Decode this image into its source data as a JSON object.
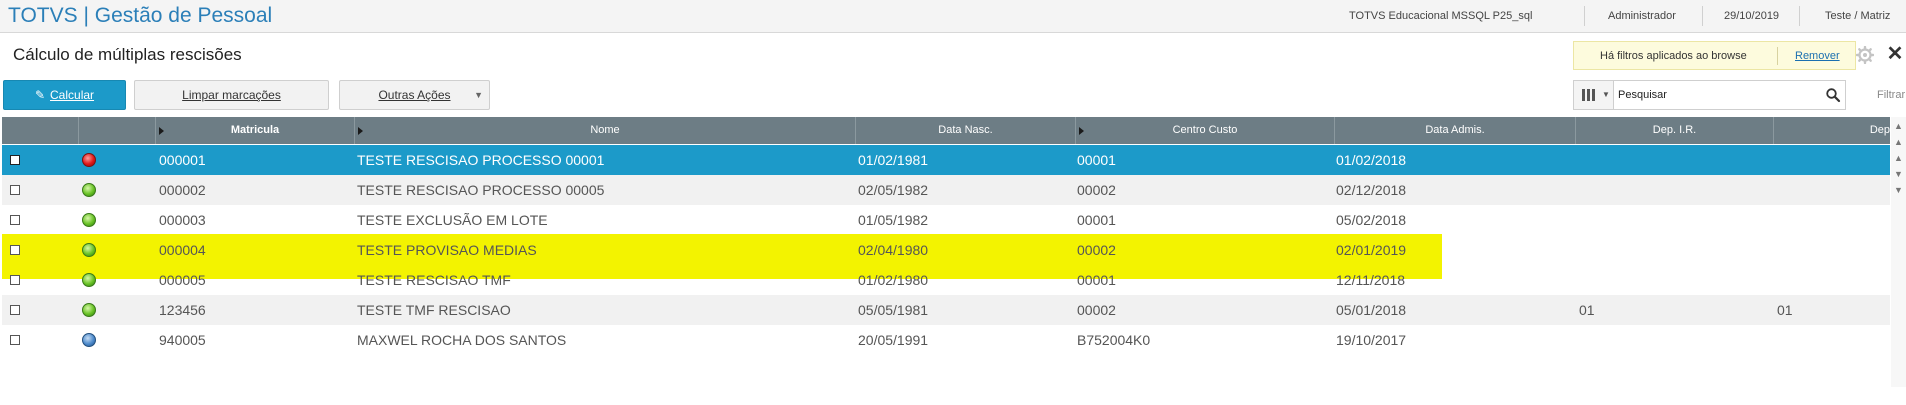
{
  "header": {
    "app_title": "TOTVS | Gestão de Pessoal",
    "environment": "TOTVS Educacional MSSQL P25_sql",
    "user": "Administrador",
    "date": "29/10/2019",
    "branch": "Teste / Matriz"
  },
  "page": {
    "title": "Cálculo de múltiplas rescisões",
    "filter_notice": "Há filtros aplicados ao browse",
    "filter_remove": "Remover",
    "gear_icon": "gear-icon",
    "close_label": "✕"
  },
  "toolbar": {
    "calcular": "Calcular",
    "limpar": "Limpar marcações",
    "outras": "Outras Ações",
    "filtrar": "Filtrar"
  },
  "search": {
    "placeholder": "Pesquisar"
  },
  "grid": {
    "columns": [
      "",
      "",
      "Matricula",
      "Nome",
      "Data Nasc.",
      "Centro Custo",
      "Data Admis.",
      "Dep. I.R.",
      "Dep"
    ],
    "rows": [
      {
        "status": "red",
        "matricula": "000001",
        "nome": "TESTE RESCISAO PROCESSO 00001",
        "nasc": "01/02/1981",
        "cc": "00001",
        "admis": "01/02/2018",
        "depir": "",
        "dep": ""
      },
      {
        "status": "green",
        "matricula": "000002",
        "nome": "TESTE RESCISAO PROCESSO 00005",
        "nasc": "02/05/1982",
        "cc": "00002",
        "admis": "02/12/2018",
        "depir": "",
        "dep": ""
      },
      {
        "status": "green",
        "matricula": "000003",
        "nome": "TESTE EXCLUSÃO EM LOTE",
        "nasc": "01/05/1982",
        "cc": "00001",
        "admis": "05/02/2018",
        "depir": "",
        "dep": ""
      },
      {
        "status": "green",
        "matricula": "000004",
        "nome": "TESTE PROVISAO MEDIAS",
        "nasc": "02/04/1980",
        "cc": "00002",
        "admis": "02/01/2019",
        "depir": "",
        "dep": ""
      },
      {
        "status": "green",
        "matricula": "000005",
        "nome": "TESTE RESCISAO TMF",
        "nasc": "01/02/1980",
        "cc": "00001",
        "admis": "12/11/2018",
        "depir": "",
        "dep": ""
      },
      {
        "status": "green",
        "matricula": "123456",
        "nome": "TESTE TMF RESCISAO",
        "nasc": "05/05/1981",
        "cc": "00002",
        "admis": "05/01/2018",
        "depir": "01",
        "dep": "01"
      },
      {
        "status": "blue",
        "matricula": "940005",
        "nome": "MAXWEL ROCHA DOS SANTOS",
        "nasc": "20/05/1991",
        "cc": "B752004K0",
        "admis": "19/10/2017",
        "depir": "",
        "dep": ""
      }
    ]
  },
  "colors": {
    "accent": "#1c9ac9",
    "header_bg": "#6d7d85",
    "highlight": "#f3f300"
  }
}
